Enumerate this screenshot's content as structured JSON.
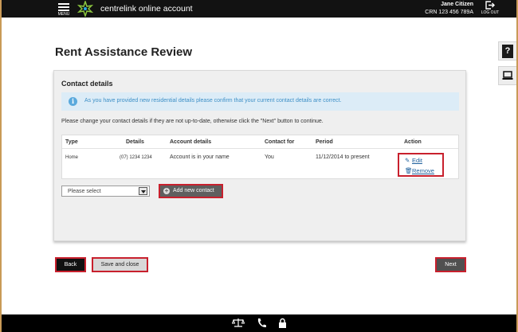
{
  "header": {
    "menu_label": "MENU",
    "app_title": "centrelink online account",
    "user_name": "Jane Citizen",
    "crn": "CRN 123 456 789A",
    "logout_label": "LOG OUT"
  },
  "side_tools": {
    "help_glyph": "?",
    "help_icon": "help-icon",
    "computer_icon": "laptop-icon"
  },
  "page_title": "Rent Assistance Review",
  "panel": {
    "title": "Contact details",
    "info_icon_glyph": "i",
    "info_text": "As you have provided new residential details please confirm that your current contact details are correct.",
    "instruction": "Please change your contact details if they are not up-to-date, otherwise click the \"Next\" button to continue."
  },
  "table": {
    "headers": [
      "Type",
      "Details",
      "Account details",
      "Contact for",
      "Period",
      "Action"
    ],
    "rows": [
      {
        "type": "Home",
        "details": "(07) 1234 1234",
        "account_details": "Account is in your name",
        "contact_for": "You",
        "period": "11/12/2014 to present",
        "edit_label": "Edit",
        "remove_label": "Remove"
      }
    ]
  },
  "select": {
    "value": "Please select"
  },
  "add_contact_label": "Add new contact",
  "buttons": {
    "back": "Back",
    "save_close": "Save and close",
    "next": "Next"
  },
  "colors": {
    "header_bg": "#121212",
    "highlight_border": "#c8202d",
    "info_bg": "#dcecf7",
    "info_text": "#3d8fc6",
    "link": "#1d5f9c",
    "logo_green": "#8cc63f"
  }
}
